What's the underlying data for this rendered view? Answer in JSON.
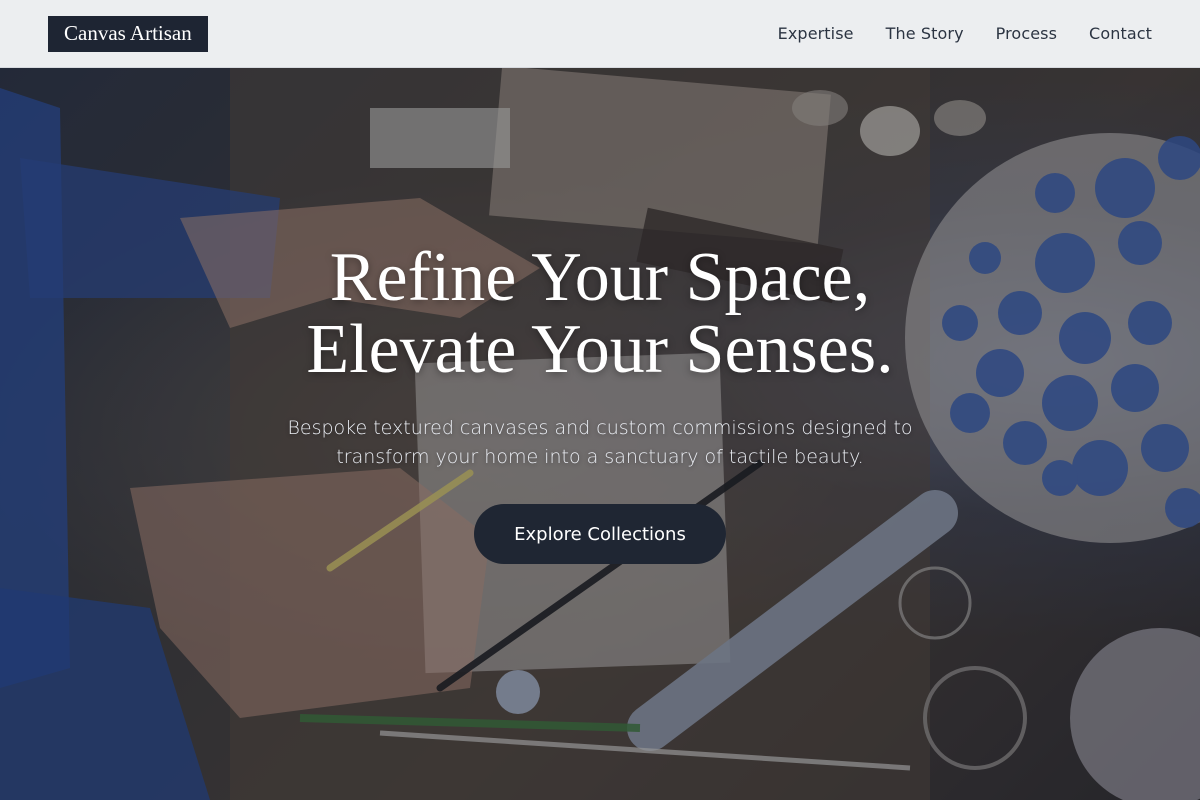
{
  "brand": {
    "name": "Canvas Artisan"
  },
  "nav": {
    "items": [
      {
        "label": "Expertise"
      },
      {
        "label": "The Story"
      },
      {
        "label": "Process"
      },
      {
        "label": "Contact"
      }
    ]
  },
  "hero": {
    "headline_line1": "Refine Your Space,",
    "headline_line2": "Elevate Your Senses.",
    "subtitle": "Bespoke textured canvases and custom commissions designed to transform your home into a sanctuary of tactile beauty.",
    "cta_label": "Explore Collections",
    "background_image": "artisan-workbench-photo"
  },
  "colors": {
    "nav_background": "#eceef0",
    "brand_background": "#1e2533",
    "cta_background": "#1f2633",
    "text_light": "#ffffff"
  }
}
